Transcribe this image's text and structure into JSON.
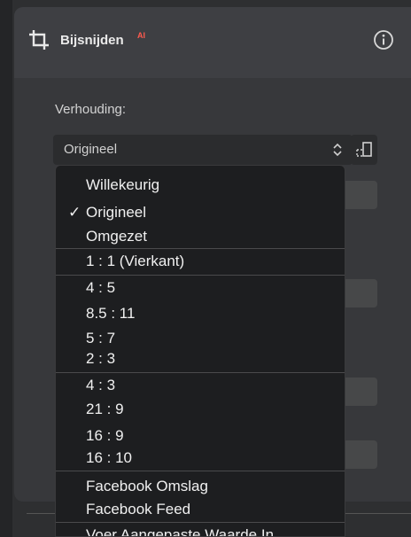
{
  "header": {
    "title": "Bijsnijden",
    "badge": "AI"
  },
  "ratio": {
    "label": "Verhouding:",
    "selected": "Origineel"
  },
  "menu": {
    "items": [
      {
        "label": "Willekeurig",
        "checked": false
      },
      {
        "label": "Origineel",
        "checked": true
      },
      {
        "label": "Omgezet",
        "checked": false
      },
      {
        "label": "1 : 1 (Vierkant)",
        "checked": false
      },
      {
        "label": "4 : 5",
        "checked": false
      },
      {
        "label": "8.5 : 11",
        "checked": false
      },
      {
        "label": "5 : 7",
        "checked": false
      },
      {
        "label": "2 : 3",
        "checked": false
      },
      {
        "label": "4 : 3",
        "checked": false
      },
      {
        "label": "21 : 9",
        "checked": false
      },
      {
        "label": "16 : 9",
        "checked": false
      },
      {
        "label": "16 : 10",
        "checked": false
      },
      {
        "label": "Facebook Omslag",
        "checked": false
      },
      {
        "label": "Facebook Feed",
        "checked": false
      },
      {
        "label": "Voer Aangepaste Waarde In...",
        "checked": false
      }
    ],
    "check_glyph": "✓"
  },
  "icons": {
    "crop": "crop-icon",
    "info": "info-icon",
    "chevron": "chevron-updown-icon",
    "swap": "swap-orientation-icon"
  },
  "colors": {
    "accent": "#ff5a4e",
    "menu_bg": "#1d1e20",
    "panel_bg": "#37383b"
  }
}
